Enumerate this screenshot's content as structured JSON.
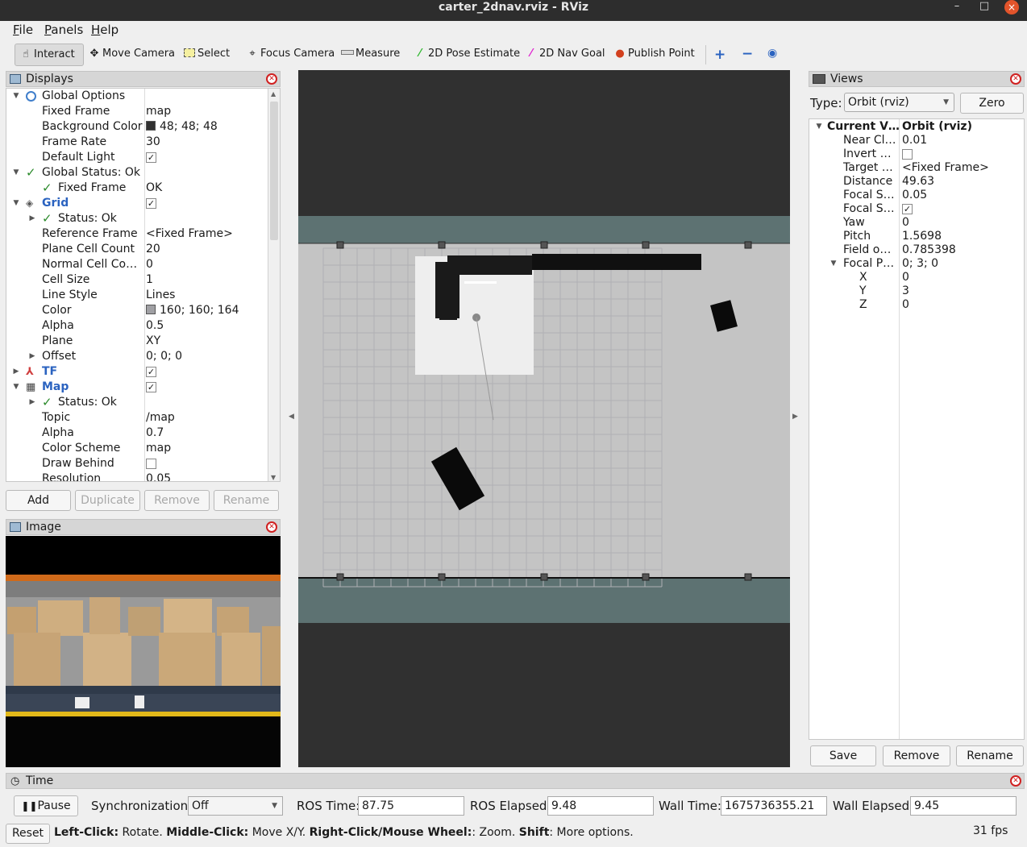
{
  "window": {
    "title": "carter_2dnav.rviz - RViz",
    "minimize": "–",
    "maximize": "□",
    "close": "×"
  },
  "menu": [
    "File",
    "Panels",
    "Help"
  ],
  "toolbar": {
    "interact": "Interact",
    "move_camera": "Move Camera",
    "select": "Select",
    "focus_camera": "Focus Camera",
    "measure": "Measure",
    "pose_estimate": "2D Pose Estimate",
    "nav_goal": "2D Nav Goal",
    "publish_point": "Publish Point"
  },
  "displays": {
    "title": "Displays",
    "rows": [
      {
        "name": "Global Options",
        "value": ""
      },
      {
        "name": "Fixed Frame",
        "value": "map"
      },
      {
        "name": "Background Color",
        "value": "48; 48; 48"
      },
      {
        "name": "Frame Rate",
        "value": "30"
      },
      {
        "name": "Default Light",
        "value": "✓"
      },
      {
        "name": "Global Status: Ok",
        "value": ""
      },
      {
        "name": "Fixed Frame",
        "value": "OK"
      },
      {
        "name": "Grid",
        "value": "✓"
      },
      {
        "name": "Status: Ok",
        "value": ""
      },
      {
        "name": "Reference Frame",
        "value": "<Fixed Frame>"
      },
      {
        "name": "Plane Cell Count",
        "value": "20"
      },
      {
        "name": "Normal Cell Co…",
        "value": "0"
      },
      {
        "name": "Cell Size",
        "value": "1"
      },
      {
        "name": "Line Style",
        "value": "Lines"
      },
      {
        "name": "Color",
        "value": "160; 160; 164"
      },
      {
        "name": "Alpha",
        "value": "0.5"
      },
      {
        "name": "Plane",
        "value": "XY"
      },
      {
        "name": "Offset",
        "value": "0; 0; 0"
      },
      {
        "name": "TF",
        "value": "✓"
      },
      {
        "name": "Map",
        "value": "✓"
      },
      {
        "name": "Status: Ok",
        "value": ""
      },
      {
        "name": "Topic",
        "value": "/map"
      },
      {
        "name": "Alpha",
        "value": "0.7"
      },
      {
        "name": "Color Scheme",
        "value": "map"
      },
      {
        "name": "Draw Behind",
        "value": ""
      },
      {
        "name": "Resolution",
        "value": "0.05"
      }
    ],
    "buttons": {
      "add": "Add",
      "duplicate": "Duplicate",
      "remove": "Remove",
      "rename": "Rename"
    },
    "colors": {
      "background": "#303030",
      "grid": "#a0a0a4"
    }
  },
  "image_panel": {
    "title": "Image"
  },
  "views": {
    "title": "Views",
    "type_label": "Type:",
    "type_value": "Orbit (rviz)",
    "zero": "Zero",
    "rows": [
      {
        "name": "Current V…",
        "value": "Orbit (rviz)"
      },
      {
        "name": "Near Cl…",
        "value": "0.01"
      },
      {
        "name": "Invert …",
        "value": ""
      },
      {
        "name": "Target …",
        "value": "<Fixed Frame>"
      },
      {
        "name": "Distance",
        "value": "49.63"
      },
      {
        "name": "Focal S…",
        "value": "0.05"
      },
      {
        "name": "Focal S…",
        "value": "✓"
      },
      {
        "name": "Yaw",
        "value": "0"
      },
      {
        "name": "Pitch",
        "value": "1.5698"
      },
      {
        "name": "Field o…",
        "value": "0.785398"
      },
      {
        "name": "Focal P…",
        "value": "0; 3; 0"
      },
      {
        "name": "X",
        "value": "0"
      },
      {
        "name": "Y",
        "value": "3"
      },
      {
        "name": "Z",
        "value": "0"
      }
    ],
    "buttons": {
      "save": "Save",
      "remove": "Remove",
      "rename": "Rename"
    }
  },
  "time": {
    "title": "Time",
    "pause": "Pause",
    "sync_label": "Synchronization:",
    "sync_value": "Off",
    "ros_time_label": "ROS Time:",
    "ros_time": "87.75",
    "ros_elapsed_label": "ROS Elapsed:",
    "ros_elapsed": "9.48",
    "wall_time_label": "Wall Time:",
    "wall_time": "1675736355.21",
    "wall_elapsed_label": "Wall Elapsed:",
    "wall_elapsed": "9.45"
  },
  "status": {
    "reset": "Reset",
    "hint_left_b": "Left-Click:",
    "hint_left": " Rotate. ",
    "hint_mid_b": "Middle-Click:",
    "hint_mid": " Move X/Y. ",
    "hint_right_b": "Right-Click/Mouse Wheel:",
    "hint_right": ": Zoom. ",
    "hint_shift_b": "Shift",
    "hint_shift": ": More options.",
    "fps": "31 fps"
  }
}
